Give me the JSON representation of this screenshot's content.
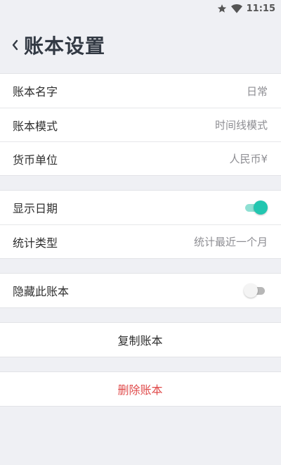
{
  "status": {
    "time": "11:15"
  },
  "header": {
    "title": "账本设置"
  },
  "basic": {
    "name_label": "账本名字",
    "name_value": "日常",
    "mode_label": "账本模式",
    "mode_value": "时间线模式",
    "currency_label": "货币单位",
    "currency_value": "人民币¥"
  },
  "display": {
    "show_date_label": "显示日期",
    "show_date_on": true,
    "stats_label": "统计类型",
    "stats_value": "统计最近一个月"
  },
  "privacy": {
    "hide_label": "隐藏此账本",
    "hide_on": false
  },
  "actions": {
    "copy_label": "复制账本",
    "delete_label": "删除账本"
  },
  "colors": {
    "accent": "#22c6b0",
    "danger": "#e04c4c"
  }
}
